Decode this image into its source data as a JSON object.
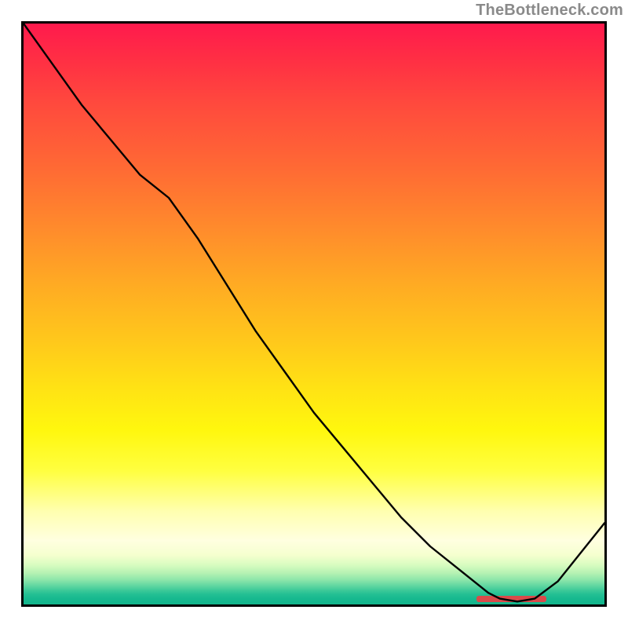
{
  "watermark": "TheBottleneck.com",
  "chart_data": {
    "type": "line",
    "title": "",
    "xlabel": "",
    "ylabel": "",
    "xlim": [
      0,
      100
    ],
    "ylim": [
      0,
      100
    ],
    "background": {
      "description": "vertical heat gradient: green (y≈0) → teal → pale yellow → yellow → orange → red (y≈100)"
    },
    "series": [
      {
        "name": "curve",
        "x": [
          0,
          5,
          10,
          15,
          20,
          25,
          30,
          35,
          40,
          45,
          50,
          55,
          60,
          65,
          70,
          75,
          80,
          82,
          85,
          88,
          92,
          96,
          100
        ],
        "y": [
          100,
          93,
          86,
          80,
          74,
          70,
          63,
          55,
          47,
          40,
          33,
          27,
          21,
          15,
          10,
          6,
          2,
          1,
          0.5,
          1,
          4,
          9,
          14
        ]
      }
    ],
    "marker": {
      "description": "flat red segment marking the minimum region",
      "x_start": 78,
      "x_end": 90,
      "y": 0.5,
      "color": "#d94a4a"
    }
  }
}
